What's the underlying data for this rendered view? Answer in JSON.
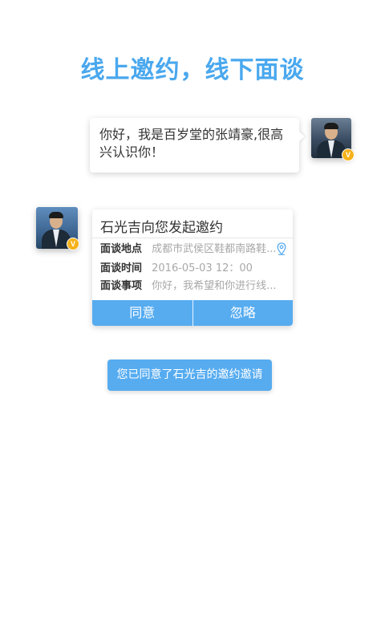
{
  "headline": "线上邀约，线下面谈",
  "chat": {
    "message": "你好，我是百岁堂的张靖豪,很高兴认识你！",
    "sender_badge": "V"
  },
  "invitation": {
    "title": "石光吉向您发起邀约",
    "fields": [
      {
        "label": "面谈地点",
        "value": "成都市武侯区鞋都南路鞋..."
      },
      {
        "label": "面谈时间",
        "value": "2016-05-03  12：00"
      },
      {
        "label": "面谈事项",
        "value": "你好，我希望和你进行线..."
      }
    ],
    "accept_label": "同意",
    "ignore_label": "忽略",
    "sender_badge": "V"
  },
  "notice": "您已同意了石光吉的邀约邀请",
  "colors": {
    "accent": "#57acf0",
    "headline": "#4aa8ee",
    "badge": "#f6b21a"
  },
  "icons": {
    "location": "location-pin-icon",
    "verified": "verified-badge-icon"
  }
}
